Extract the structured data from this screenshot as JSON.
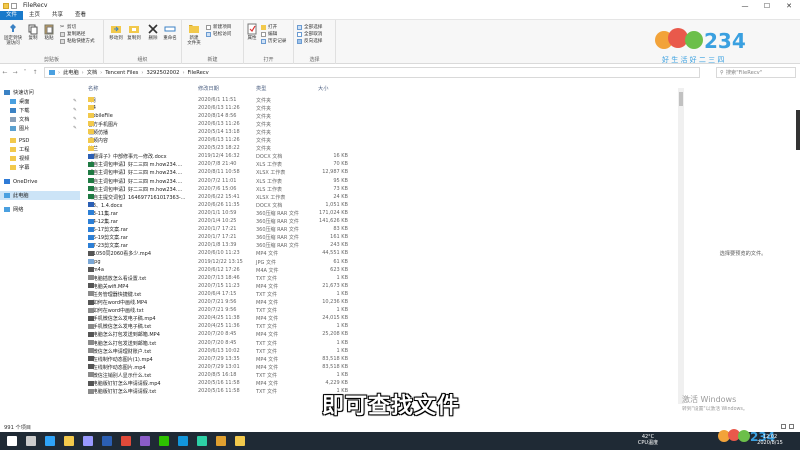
{
  "window": {
    "title": "FileRecv",
    "min": "—",
    "max": "☐",
    "close": "✕"
  },
  "menus": [
    "文件",
    "主页",
    "共享",
    "查看"
  ],
  "ribbon": {
    "clipboard": {
      "label": "剪贴板",
      "pin": "固定到快速访问",
      "copy": "复制",
      "paste": "粘贴",
      "cut": "剪切",
      "copy_path": "复制路径",
      "paste_shortcut": "粘贴快捷方式"
    },
    "organize": {
      "label": "组织",
      "move_to": "移动到",
      "copy_to": "复制到",
      "delete": "删除",
      "rename": "重命名"
    },
    "new": {
      "label": "新建",
      "new_folder": "新建\n文件夹",
      "new_item": "新建项目",
      "easy_access": "轻松访问"
    },
    "open": {
      "label": "打开",
      "properties": "属性",
      "open": "打开",
      "edit": "编辑",
      "history": "历史记录"
    },
    "select": {
      "label": "选择",
      "select_all": "全部选择",
      "select_none": "全部取消",
      "invert": "反向选择"
    }
  },
  "logo": {
    "text": "好 生 活 好 二 三 四",
    "brand": "HOW234"
  },
  "address": {
    "path": [
      "此电脑",
      "文档",
      "Tencent Files",
      "3292502002",
      "FileRecv"
    ]
  },
  "search": {
    "placeholder": "搜索\"FileRecv\""
  },
  "nav": [
    {
      "label": "快速访问",
      "icon": "star-icon",
      "color": "#3b82c4"
    },
    {
      "label": "桌面",
      "icon": "desktop-icon",
      "color": "#4aa0e0",
      "pin": true
    },
    {
      "label": "下载",
      "icon": "download-icon",
      "color": "#3b82c4",
      "pin": true
    },
    {
      "label": "文档",
      "icon": "document-icon",
      "color": "#8aa0b8",
      "pin": true
    },
    {
      "label": "图片",
      "icon": "picture-icon",
      "color": "#5aa0d0",
      "pin": true
    },
    {
      "label": "PSD",
      "icon": "folder-icon",
      "color": "#f2c94c"
    },
    {
      "label": "工程",
      "icon": "folder-icon",
      "color": "#f2c94c"
    },
    {
      "label": "视频",
      "icon": "folder-icon",
      "color": "#f2c94c"
    },
    {
      "label": "字幕",
      "icon": "folder-icon",
      "color": "#f2c94c"
    },
    {
      "label": "OneDrive",
      "icon": "cloud-icon",
      "color": "#2f7bd6"
    },
    {
      "label": "此电脑",
      "icon": "computer-icon",
      "color": "#4aa0e0",
      "selected": true
    },
    {
      "label": "网络",
      "icon": "network-icon",
      "color": "#4aa0e0"
    }
  ],
  "columns": {
    "name": "名称",
    "date": "修改日期",
    "type": "类型",
    "size": "大小"
  },
  "files": [
    {
      "name": "5月",
      "date": "2020/6/1 11:51",
      "type": "文件夹",
      "size": "",
      "color": "#f2c94c"
    },
    {
      "name": "6.4",
      "date": "2020/6/13 11:26",
      "type": "文件夹",
      "size": "",
      "color": "#f2c94c"
    },
    {
      "name": "MobileFile",
      "date": "2020/8/14 8:56",
      "type": "文件夹",
      "size": "",
      "color": "#f2c94c"
    },
    {
      "name": "官方手机图片",
      "date": "2020/6/13 11:26",
      "type": "文件夹",
      "size": "",
      "color": "#f2c94c"
    },
    {
      "name": "视频仿播",
      "date": "2020/5/14 13:18",
      "type": "文件夹",
      "size": "",
      "color": "#f2c94c"
    },
    {
      "name": "视频内容",
      "date": "2020/6/13 11:26",
      "type": "文件夹",
      "size": "",
      "color": "#f2c94c"
    },
    {
      "name": "藏兰",
      "date": "2020/5/23 18:22",
      "type": "文件夹",
      "size": "",
      "color": "#f2c94c"
    },
    {
      "name": "《翻译子》中部修事元—修改.docx",
      "date": "2019/12/4 16:32",
      "type": "DOCX 文档",
      "size": "16 KB",
      "color": "#2b5fb4"
    },
    {
      "name": "【自主词包申请】好二三四 m.how234....",
      "date": "2020/7/8 21:40",
      "type": "XLS 工作表",
      "size": "70 KB",
      "color": "#1f7a43"
    },
    {
      "name": "【自主词包申请】好二三四 m.how234....",
      "date": "2020/8/11 10:58",
      "type": "XLSX 工作表",
      "size": "12,987 KB",
      "color": "#1f7a43"
    },
    {
      "name": "【自主词包申请】好二三四 m.how234....",
      "date": "2020/7/2 11:01",
      "type": "XLS 工作表",
      "size": "95 KB",
      "color": "#1f7a43"
    },
    {
      "name": "【自主词包申请】好二三四 m.how234....",
      "date": "2020/7/6 15:06",
      "type": "XLS 工作表",
      "size": "73 KB",
      "color": "#1f7a43"
    },
    {
      "name": "【自主提交词包】1646977161017363-...",
      "date": "2020/6/22 15:41",
      "type": "XLSX 工作表",
      "size": "24 KB",
      "color": "#1f7a43"
    },
    {
      "name": "1.3、1.4.docx",
      "date": "2020/6/26 11:35",
      "type": "DOCX 文档",
      "size": "1,051 KB",
      "color": "#2b5fb4"
    },
    {
      "name": "1.3-11集.rar",
      "date": "2020/1/1 10:59",
      "type": "360压缩 RAR 文件",
      "size": "171,024 KB",
      "color": "#2c7fd6"
    },
    {
      "name": "1.4-12集.rar",
      "date": "2020/1/4 10:25",
      "type": "360压缩 RAR 文件",
      "size": "141,626 KB",
      "color": "#2c7fd6"
    },
    {
      "name": "1.5-17剪文案.rar",
      "date": "2020/1/7 17:21",
      "type": "360压缩 RAR 文件",
      "size": "83 KB",
      "color": "#2c7fd6"
    },
    {
      "name": "1.6-19剪文案.rar",
      "date": "2020/1/7 17:21",
      "type": "360压缩 RAR 文件",
      "size": "161 KB",
      "color": "#2c7fd6"
    },
    {
      "name": "1.7-23剪文案.rar",
      "date": "2020/1/8 13:39",
      "type": "360压缩 RAR 文件",
      "size": "243 KB",
      "color": "#2c7fd6"
    },
    {
      "name": "1.1050同2060看多少.mp4",
      "date": "2020/6/10 11:23",
      "type": "MP4 文件",
      "size": "44,551 KB",
      "color": "#555555"
    },
    {
      "name": "1.jpg",
      "date": "2019/12/22 13:15",
      "type": "JPG 文件",
      "size": "61 KB",
      "color": "#7aa7d6"
    },
    {
      "name": "1.m4a",
      "date": "2020/6/12 17:26",
      "type": "M4A 文件",
      "size": "623 KB",
      "color": "#555555"
    },
    {
      "name": "1.电脑插放怎么看设置.txt",
      "date": "2020/7/13 18:46",
      "type": "TXT 文件",
      "size": "1 KB",
      "color": "#8a8a8a"
    },
    {
      "name": "1.电脑关wifi.MP4",
      "date": "2020/7/15 11:23",
      "type": "MP4 文件",
      "size": "21,673 KB",
      "color": "#555555"
    },
    {
      "name": "1.任务管理器快捷键.txt",
      "date": "2020/6/4 17:15",
      "type": "TXT 文件",
      "size": "1 KB",
      "color": "#8a8a8a"
    },
    {
      "name": "1.如何在word中画线.MP4",
      "date": "2020/7/21 9:56",
      "type": "MP4 文件",
      "size": "10,236 KB",
      "color": "#555555"
    },
    {
      "name": "1.如何在word中画线.txt",
      "date": "2020/7/21 9:56",
      "type": "TXT 文件",
      "size": "1 KB",
      "color": "#8a8a8a"
    },
    {
      "name": "1.手机微信怎么发电子稿.mp4",
      "date": "2020/4/25 11:38",
      "type": "MP4 文件",
      "size": "24,015 KB",
      "color": "#555555"
    },
    {
      "name": "1.手机微信怎么发电子稿.txt",
      "date": "2020/4/25 11:36",
      "type": "TXT 文件",
      "size": "1 KB",
      "color": "#8a8a8a"
    },
    {
      "name": "1.电脑怎么打包发送到邮箱.MP4",
      "date": "2020/7/20 8:45",
      "type": "MP4 文件",
      "size": "25,208 KB",
      "color": "#555555"
    },
    {
      "name": "1.电脑怎么打包发送到邮箱.txt",
      "date": "2020/7/20 8:45",
      "type": "TXT 文件",
      "size": "1 KB",
      "color": "#8a8a8a"
    },
    {
      "name": "1.微信怎么申请理财账户.txt",
      "date": "2020/6/13 10:02",
      "type": "TXT 文件",
      "size": "1 KB",
      "color": "#8a8a8a"
    },
    {
      "name": "1.在线制作动态图片(1).mp4",
      "date": "2020/7/29 13:35",
      "type": "MP4 文件",
      "size": "83,518 KB",
      "color": "#555555"
    },
    {
      "name": "1.在线制作动态图片.mp4",
      "date": "2020/7/29 13:01",
      "type": "MP4 文件",
      "size": "83,518 KB",
      "color": "#555555"
    },
    {
      "name": "1.微信注销别人显示什么.txt",
      "date": "2020/8/5 16:18",
      "type": "TXT 文件",
      "size": "1 KB",
      "color": "#8a8a8a"
    },
    {
      "name": "1.电脑版钉钉怎么申请请假.mp4",
      "date": "2020/5/16 11:58",
      "type": "MP4 文件",
      "size": "4,229 KB",
      "color": "#555555"
    },
    {
      "name": "1.电脑版钉钉怎么申请请假.txt",
      "date": "2020/5/16 11:58",
      "type": "TXT 文件",
      "size": "1 KB",
      "color": "#8a8a8a"
    }
  ],
  "preview": {
    "message": "选择要预览的文件。"
  },
  "activation": {
    "line1": "激活 Windows",
    "line2": "转到\"设置\"以激活 Windows。"
  },
  "subtitle": "即可查找文件",
  "status": {
    "count": "991 个项目"
  },
  "taskbar": {
    "apps": [
      {
        "name": "start-icon",
        "color": "#ffffff"
      },
      {
        "name": "search-icon",
        "color": "#cccccc"
      },
      {
        "name": "photoshop-icon",
        "color": "#2fa3f7"
      },
      {
        "name": "file-explorer-icon",
        "color": "#f2c94c"
      },
      {
        "name": "premiere-icon",
        "color": "#9999ff"
      },
      {
        "name": "word-icon",
        "color": "#2b5fb4"
      },
      {
        "name": "chrome-icon",
        "color": "#e04a3a"
      },
      {
        "name": "media-encoder-icon",
        "color": "#8a5cc8"
      },
      {
        "name": "wechat-icon",
        "color": "#2dc100"
      },
      {
        "name": "qq-icon",
        "color": "#1296db"
      },
      {
        "name": "audition-icon",
        "color": "#2dd0a6"
      },
      {
        "name": "app-icon",
        "color": "#e0a030"
      },
      {
        "name": "folder-icon",
        "color": "#f2c94c"
      }
    ],
    "weather": {
      "temp": "42°C",
      "desc": "CPU温度"
    },
    "time": "12:02",
    "date": "2020/8/15"
  }
}
